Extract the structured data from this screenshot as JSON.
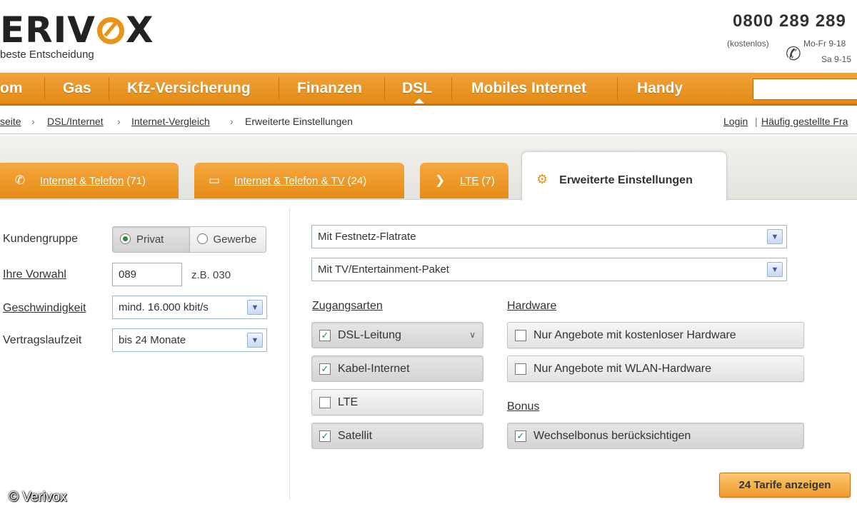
{
  "header": {
    "logo_text": "ERIVOX",
    "logo_prefix": "",
    "tagline": "beste Entscheidung",
    "phone": "0800 289 289",
    "phone_note": "(kostenlos)",
    "hours_weekday": "Mo-Fr 9-18",
    "hours_saturday": "Sa 9-15"
  },
  "nav": {
    "items": [
      "om",
      "Gas",
      "Kfz-Versicherung",
      "Finanzen",
      "DSL",
      "Mobiles Internet",
      "Handy"
    ],
    "active": "DSL",
    "search_placeholder": ""
  },
  "breadcrumb": {
    "items": [
      "seite",
      "DSL/Internet",
      "Internet-Vergleich"
    ],
    "current": "Erweiterte Einstellungen",
    "separator": "›",
    "right_links": [
      "Login",
      "Häufig gestellte Fra"
    ],
    "right_sep": "|"
  },
  "tabs": [
    {
      "label": "Internet & Telefon",
      "count": "(71)",
      "icon": "phone-icon"
    },
    {
      "label": "Internet & Telefon & TV",
      "count": "(24)",
      "icon": "tv-icon"
    },
    {
      "label": "LTE",
      "count": "(7)",
      "icon": "rss-icon"
    }
  ],
  "active_tab": {
    "label": "Erweiterte Einstellungen",
    "icon": "gears-icon"
  },
  "form": {
    "kundengruppe_label": "Kundengruppe",
    "kundengruppe_options": [
      "Privat",
      "Gewerbe"
    ],
    "kundengruppe_selected": "Privat",
    "vorwahl_label": "Ihre Vorwahl",
    "vorwahl_value": "089",
    "vorwahl_hint": "z.B. 030",
    "speed_label": "Geschwindigkeit",
    "speed_value": "mind. 16.000 kbit/s",
    "contract_label": "Vertragslaufzeit",
    "contract_value": "bis 24 Monate"
  },
  "filters": {
    "festnetz": "Mit Festnetz-Flatrate",
    "tv": "Mit TV/Entertainment-Paket",
    "access_title": "Zugangsarten",
    "access": [
      {
        "label": "DSL-Leitung",
        "checked": true
      },
      {
        "label": "Kabel-Internet",
        "checked": true
      },
      {
        "label": "LTE",
        "checked": false
      },
      {
        "label": "Satellit",
        "checked": true
      }
    ],
    "hardware_title": "Hardware",
    "hardware": [
      {
        "label": "Nur Angebote mit kostenloser Hardware",
        "checked": false
      },
      {
        "label": "Nur Angebote mit WLAN-Hardware",
        "checked": false
      }
    ],
    "bonus_title": "Bonus",
    "bonus": [
      {
        "label": "Wechselbonus berücksichtigen",
        "checked": true
      }
    ]
  },
  "cta": "24 Tarife anzeigen",
  "copyright": "© Verivox",
  "colors": {
    "accent": "#e8941a",
    "check": "#2f8a3a"
  }
}
